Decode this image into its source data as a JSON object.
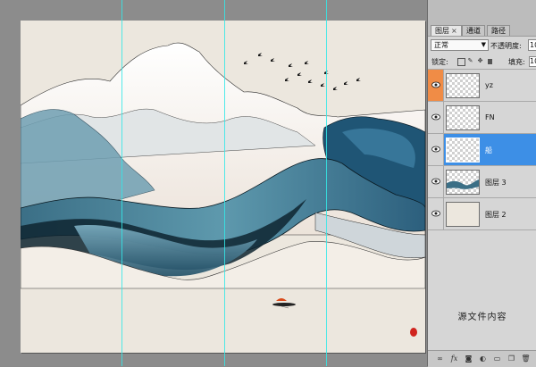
{
  "panel": {
    "tabs": [
      {
        "label": "图层",
        "close": "×"
      },
      {
        "label": "通道"
      },
      {
        "label": "路径"
      }
    ],
    "blend_mode": "正常",
    "opacity_label": "不透明度:",
    "opacity_value": "100",
    "lock_label": "锁定:",
    "fill_label": "填充:",
    "fill_value": "100",
    "layers": [
      {
        "name": "yz"
      },
      {
        "name": "FN"
      },
      {
        "name": "船"
      },
      {
        "name": "图层 3"
      },
      {
        "name": "图层 2"
      }
    ],
    "source_label": "源文件内容"
  },
  "colors": {
    "guide": "#34e8e8",
    "selected_layer": "#3d8fe6",
    "visibility_highlight": "#f08c46",
    "canvas_bg": "#ece7de"
  }
}
